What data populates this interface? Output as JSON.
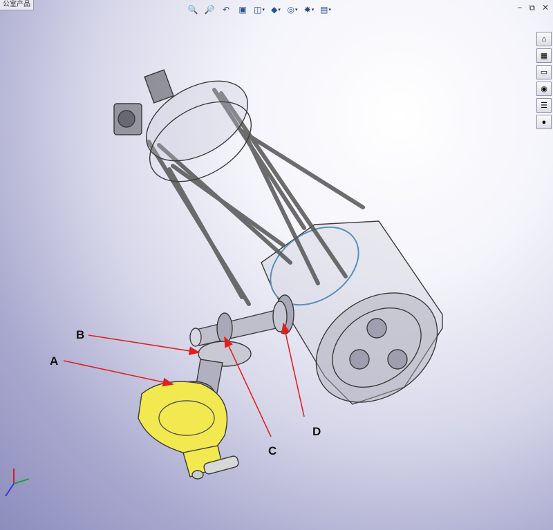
{
  "window": {
    "tab_label": "公室产品"
  },
  "toolbar": {
    "icons": [
      "zoom-to-fit-icon",
      "zoom-area-icon",
      "previous-view-icon",
      "section-view-icon",
      "view-orientation-icon",
      "display-style-icon",
      "hide-show-icon",
      "edit-appearance-icon",
      "view-settings-icon"
    ]
  },
  "window_controls": {
    "minimize": "−",
    "restore": "⧉",
    "close": "✕"
  },
  "task_pane": {
    "icons": [
      "home-icon",
      "library-icon",
      "file-explorer-icon",
      "search-icon",
      "properties-icon",
      "appearance-icon"
    ]
  },
  "callouts": {
    "A": "A",
    "B": "B",
    "C": "C",
    "D": "D"
  },
  "colors": {
    "callout_arrow": "#e02020",
    "base_plate": "#f2e84f",
    "model_lines": "#3a3a3a"
  }
}
